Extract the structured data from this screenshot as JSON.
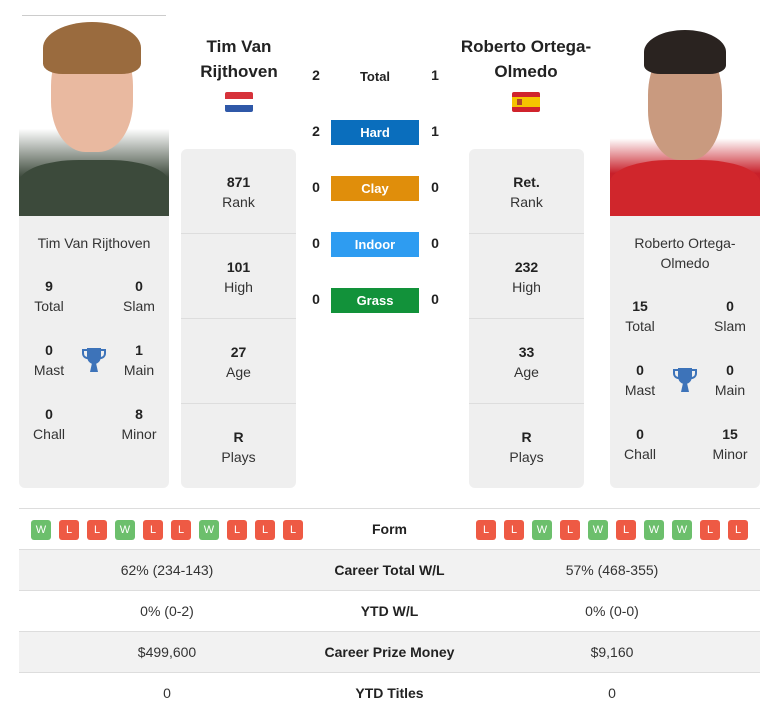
{
  "colors": {
    "win": "#6cbf6c",
    "loss": "#ee5a44",
    "hard": "#0a6ebd",
    "clay": "#e08e0b",
    "indoor": "#2e9cf1",
    "grass": "#12923a",
    "trophy": "#3d73b9"
  },
  "player1": {
    "name": "Tim Van Rijthoven",
    "name_line1": "Tim Van",
    "name_line2": "Rijthoven",
    "flag": "netherlands-flag",
    "card_name": "Tim Van Rijthoven",
    "titles": {
      "total": {
        "value": "9",
        "label": "Total"
      },
      "slam": {
        "value": "0",
        "label": "Slam"
      },
      "mast": {
        "value": "0",
        "label": "Mast"
      },
      "main": {
        "value": "1",
        "label": "Main"
      },
      "chall": {
        "value": "0",
        "label": "Chall"
      },
      "minor": {
        "value": "8",
        "label": "Minor"
      }
    },
    "info": [
      {
        "value": "871",
        "label": "Rank"
      },
      {
        "value": "101",
        "label": "High"
      },
      {
        "value": "27",
        "label": "Age"
      },
      {
        "value": "R",
        "label": "Plays"
      }
    ],
    "form": [
      "W",
      "L",
      "L",
      "W",
      "L",
      "L",
      "W",
      "L",
      "L",
      "L"
    ]
  },
  "player2": {
    "name": "Roberto Ortega-Olmedo",
    "name_line1": "Roberto Ortega-",
    "name_line2": "Olmedo",
    "flag": "spain-flag",
    "card_name_line1": "Roberto Ortega-",
    "card_name_line2": "Olmedo",
    "titles": {
      "total": {
        "value": "15",
        "label": "Total"
      },
      "slam": {
        "value": "0",
        "label": "Slam"
      },
      "mast": {
        "value": "0",
        "label": "Mast"
      },
      "main": {
        "value": "0",
        "label": "Main"
      },
      "chall": {
        "value": "0",
        "label": "Chall"
      },
      "minor": {
        "value": "15",
        "label": "Minor"
      }
    },
    "info": [
      {
        "value": "Ret.",
        "label": "Rank"
      },
      {
        "value": "232",
        "label": "High"
      },
      {
        "value": "33",
        "label": "Age"
      },
      {
        "value": "R",
        "label": "Plays"
      }
    ],
    "form": [
      "L",
      "L",
      "W",
      "L",
      "W",
      "L",
      "W",
      "W",
      "L",
      "L"
    ]
  },
  "h2h": [
    {
      "label": "Total",
      "p1": "2",
      "p2": "1"
    },
    {
      "label": "Hard",
      "p1": "2",
      "p2": "1"
    },
    {
      "label": "Clay",
      "p1": "0",
      "p2": "0"
    },
    {
      "label": "Indoor",
      "p1": "0",
      "p2": "0"
    },
    {
      "label": "Grass",
      "p1": "0",
      "p2": "0"
    }
  ],
  "stats": [
    {
      "label": "Form"
    },
    {
      "label": "Career Total W/L",
      "p1": "62% (234-143)",
      "p2": "57% (468-355)"
    },
    {
      "label": "YTD W/L",
      "p1": "0% (0-2)",
      "p2": "0% (0-0)"
    },
    {
      "label": "Career Prize Money",
      "p1": "$499,600",
      "p2": "$9,160"
    },
    {
      "label": "YTD Titles",
      "p1": "0",
      "p2": "0"
    }
  ]
}
